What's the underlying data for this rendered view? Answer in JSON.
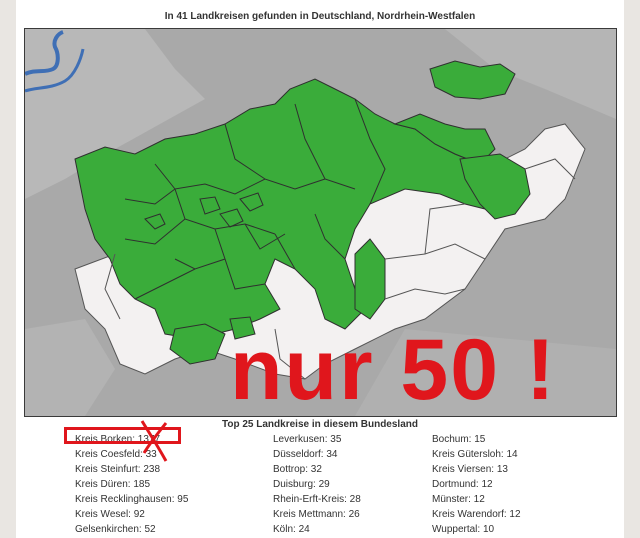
{
  "header": {
    "title": "In 41 Landkreisen gefunden in Deutschland, Nordrhein-Westfalen"
  },
  "map": {
    "overlay_text": "nur 50 !",
    "colors": {
      "found": "#3aac3a",
      "not_found": "#f3f1f1",
      "outside": "#a9a9a9",
      "water": "#3f6fb5",
      "annotation": "#e0161c"
    }
  },
  "top_list": {
    "title": "Top 25 Landkreise in diesem Bundesland",
    "columns": [
      [
        "Kreis Borken: 1377",
        "Kreis Coesfeld: 33",
        "Kreis Steinfurt: 238",
        "Kreis Düren: 185",
        "Kreis Recklinghausen: 95",
        "Kreis Wesel: 92",
        "Gelsenkirchen: 52"
      ],
      [
        "Leverkusen: 35",
        "Düsseldorf: 34",
        "Bottrop: 32",
        "Duisburg: 29",
        "Rhein-Erft-Kreis: 28",
        "Kreis Mettmann: 26",
        "Köln: 24"
      ],
      [
        "Bochum: 15",
        "Kreis Gütersloh: 14",
        "Kreis Viersen: 13",
        "Dortmund: 12",
        "Münster: 12",
        "Kreis Warendorf: 12",
        "Wuppertal: 10"
      ]
    ]
  }
}
